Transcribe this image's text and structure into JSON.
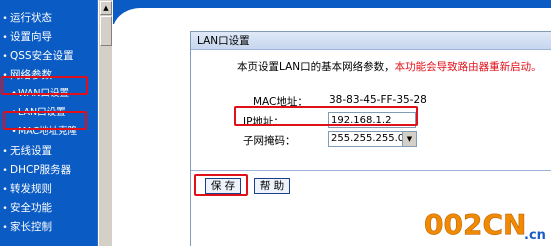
{
  "sidebar": {
    "items": [
      {
        "label": "运行状态",
        "level": 0
      },
      {
        "label": "设置向导",
        "level": 0
      },
      {
        "label": "QSS安全设置",
        "level": 0
      },
      {
        "label": "网络参数",
        "level": 0
      },
      {
        "label": "WAN口设置",
        "level": 1
      },
      {
        "label": "LAN口设置",
        "level": 1
      },
      {
        "label": "MAC地址克隆",
        "level": 1
      },
      {
        "label": "无线设置",
        "level": 0
      },
      {
        "label": "DHCP服务器",
        "level": 0
      },
      {
        "label": "转发规则",
        "level": 0
      },
      {
        "label": "安全功能",
        "level": 0
      },
      {
        "label": "家长控制",
        "level": 0
      }
    ],
    "scroll_up_glyph": "▲"
  },
  "panel": {
    "title": "LAN口设置",
    "intro": "本页设置LAN口的基本网络参数，",
    "warning": "本功能会导致路由器重新启动。",
    "mac_label": "MAC地址：",
    "mac_value": "38-83-45-FF-35-28",
    "ip_label": "IP地址：",
    "ip_value": "192.168.1.2",
    "mask_label": "子网掩码：",
    "mask_value": "255.255.255.0",
    "save_label": "保 存",
    "help_label": "帮 助"
  },
  "watermark": {
    "text_main": "002CN",
    "text_suffix": ".cn"
  },
  "colors": {
    "sidebar_bg": "#0a5bc4",
    "highlight_red": "#e0101a",
    "logo_orange": "#f08a00",
    "logo_blue": "#1b5fc6"
  }
}
